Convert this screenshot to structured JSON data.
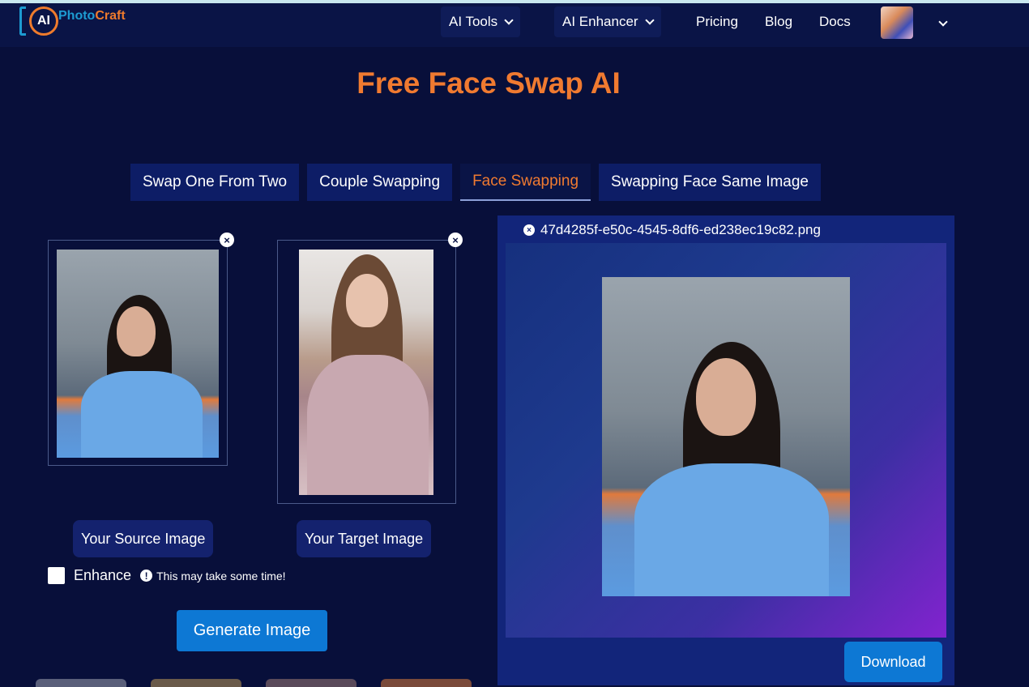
{
  "nav": {
    "logo_text": "AI",
    "logo_word_a": "Photo",
    "logo_word_b": "Craft",
    "ai_tools": "AI Tools",
    "ai_enhancer": "AI Enhancer",
    "pricing": "Pricing",
    "blog": "Blog",
    "docs": "Docs"
  },
  "page": {
    "title": "Free Face Swap AI"
  },
  "tabs": [
    {
      "label": "Swap One From Two",
      "active": false
    },
    {
      "label": "Couple Swapping",
      "active": false
    },
    {
      "label": "Face Swapping",
      "active": true
    },
    {
      "label": "Swapping Face Same Image",
      "active": false
    }
  ],
  "source": {
    "button": "Your Source Image"
  },
  "target": {
    "button": "Your Target Image"
  },
  "enhance": {
    "label": "Enhance",
    "note": "This may take some time!",
    "checked": false
  },
  "generate_button": "Generate Image",
  "result": {
    "filename": "47d4285f-e50c-4545-8df6-ed238ec19c82.png",
    "download_button": "Download"
  },
  "colors": {
    "accent_orange": "#f07a30",
    "button_blue": "#0d78d4",
    "background": "#080f3a"
  }
}
